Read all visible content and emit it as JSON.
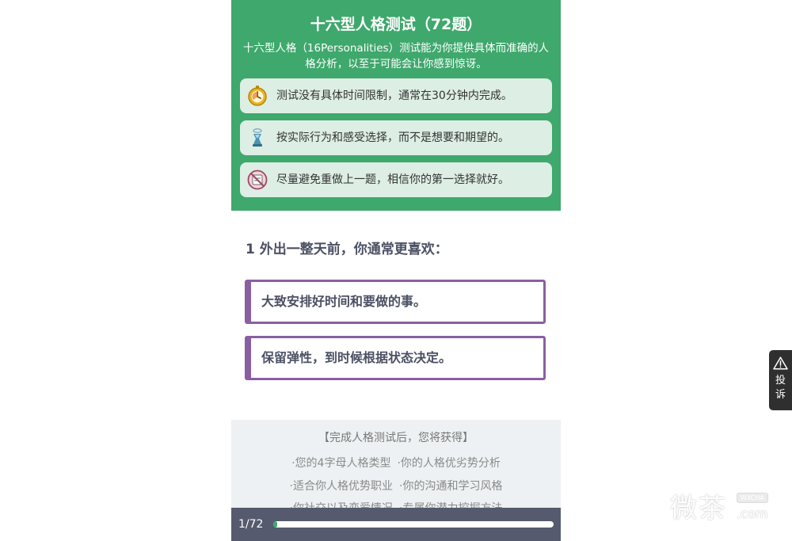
{
  "header": {
    "title": "十六型人格测试（72题）",
    "description": "十六型人格（16Personalities）测试能为你提供具体而准确的人格分析，以至于可能会让你感到惊讶。",
    "tips": [
      {
        "icon": "stopwatch-icon",
        "text": "测试没有具体时间限制，通常在30分钟内完成。"
      },
      {
        "icon": "hourglass-figure-icon",
        "text": "按实际行为和感受选择，而不是想要和期望的。"
      },
      {
        "icon": "no-repeat-icon",
        "text": "尽量避免重做上一题，相信你的第一选择就好。"
      }
    ]
  },
  "question": {
    "text": "1 外出一整天前，你通常更喜欢：",
    "options": [
      "大致安排好时间和要做的事。",
      "保留弹性，到时候根据状态决定。"
    ]
  },
  "benefits": {
    "title": "【完成人格测试后，您将获得】",
    "rows": [
      [
        "·您的4字母人格类型",
        "·你的人格优劣势分析"
      ],
      [
        "·适合你人格优势职业",
        "·你的沟通和学习风格"
      ],
      [
        "·你社交以及恋爱情况",
        "·专属你潜力挖掘方法"
      ]
    ]
  },
  "progress": {
    "label": "1/72",
    "fraction": 0.014
  },
  "report_button": {
    "label": "投诉",
    "icon": "warning-icon"
  },
  "watermark": {
    "text": "微茶",
    "badge": "WXCHA",
    "domain": ".com"
  },
  "colors": {
    "header_green": "#3fa86c",
    "option_border": "#8a5fa2",
    "progress_bg": "#555a6e"
  }
}
